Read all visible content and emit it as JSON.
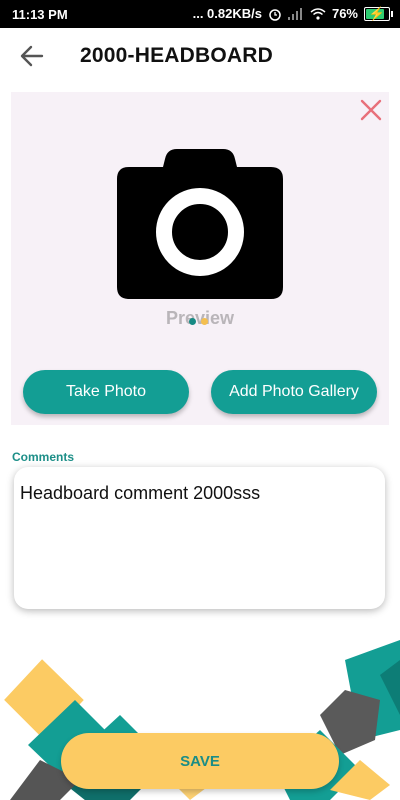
{
  "status_bar": {
    "time": "11:13 PM",
    "network_speed": "... 0.82KB/s",
    "battery_percent": "76%",
    "icons": [
      "alarm-icon",
      "signal-icon",
      "wifi-icon",
      "battery-icon"
    ]
  },
  "header": {
    "title": "2000-HEADBOARD",
    "back_icon": "arrow-left-icon"
  },
  "preview": {
    "label": "Preview",
    "close_icon": "close-icon",
    "camera_icon": "camera-icon",
    "take_photo_label": "Take Photo",
    "add_gallery_label": "Add Photo Gallery"
  },
  "comments": {
    "label": "Comments",
    "value": "Headboard comment 2000sss"
  },
  "footer": {
    "save_label": "SAVE"
  },
  "colors": {
    "accent_teal": "#139e94",
    "save_yellow": "#fccb63",
    "close_red": "#e8707a",
    "card_bg": "#f7f1f7"
  }
}
